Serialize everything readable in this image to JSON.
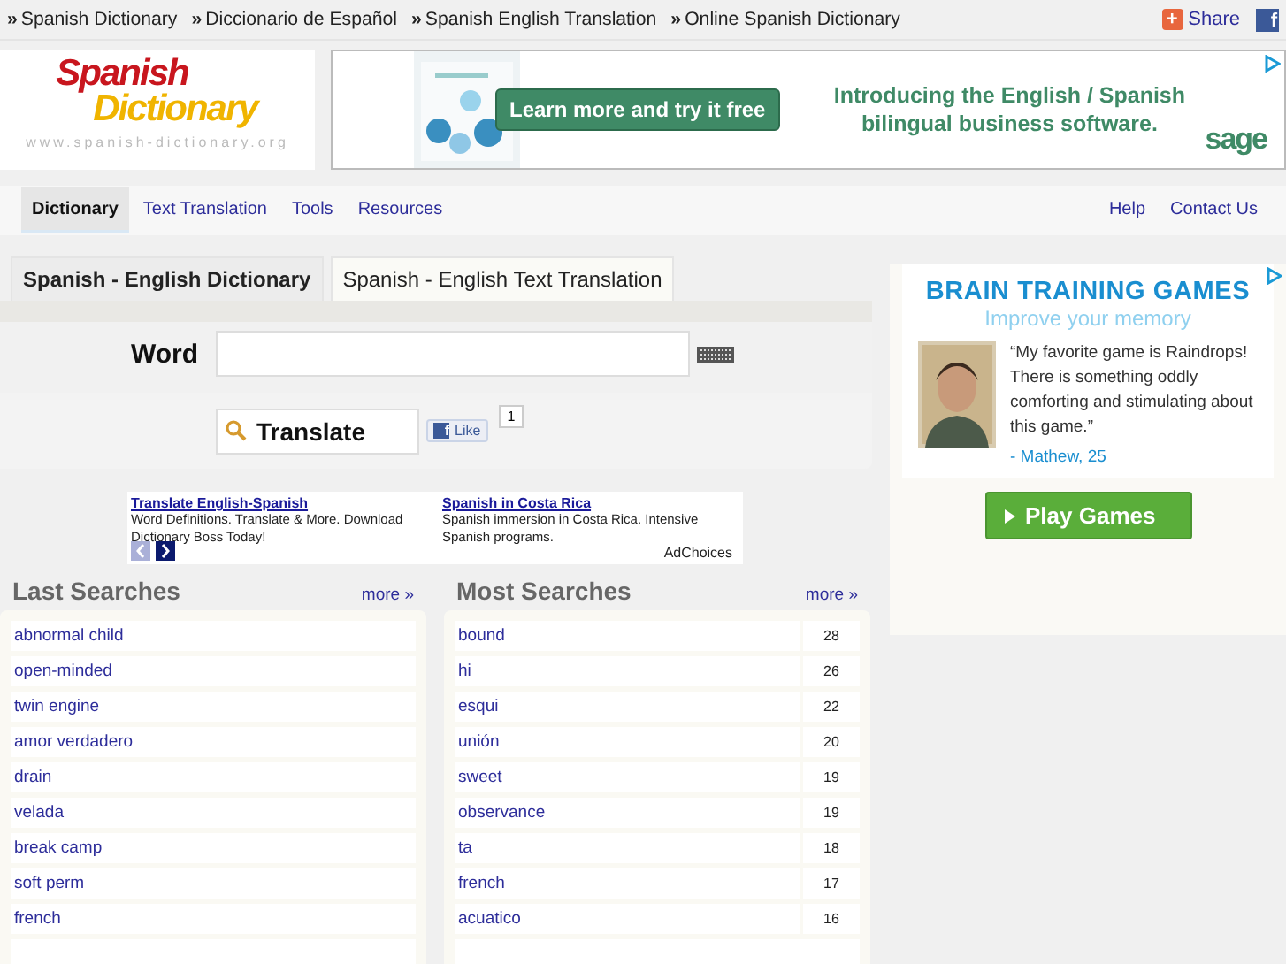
{
  "top_links": [
    {
      "arrow": "»",
      "label": "Spanish Dictionary"
    },
    {
      "arrow": "»",
      "label": "Diccionario de Español"
    },
    {
      "arrow": "»",
      "label": "Spanish English Translation"
    },
    {
      "arrow": "»",
      "label": "Online Spanish Dictionary"
    }
  ],
  "share": {
    "label": "Share",
    "plus": "+",
    "fb": "f"
  },
  "logo": {
    "line1": "Spanish",
    "line2": "Dictionary",
    "url": "www.spanish-dictionary.org"
  },
  "banner": {
    "button": "Learn more and try it free",
    "headline": "Introducing the English / Spanish bilingual business software.",
    "brand": "sage"
  },
  "nav": {
    "items": [
      {
        "label": "Dictionary",
        "selected": true
      },
      {
        "label": "Text Translation",
        "selected": false
      },
      {
        "label": "Tools",
        "selected": false
      },
      {
        "label": "Resources",
        "selected": false
      }
    ],
    "right": [
      {
        "label": "Help"
      },
      {
        "label": "Contact Us"
      }
    ]
  },
  "tabs": [
    {
      "label": "Spanish - English Dictionary",
      "selected": true
    },
    {
      "label": "Spanish - English Text Translation",
      "selected": false
    }
  ],
  "form": {
    "word_label": "Word",
    "translate": "Translate",
    "like": "Like",
    "fb": "f",
    "like_count": "1"
  },
  "text_ads": [
    {
      "title": "Translate English-Spanish",
      "body": "Word Definitions. Translate & More. Download Dictionary Boss Today!"
    },
    {
      "title": "Spanish in Costa Rica",
      "body": "Spanish immersion in Costa Rica. Intensive Spanish programs."
    }
  ],
  "adchoices": "AdChoices",
  "last_searches": {
    "title": "Last Searches",
    "more": "more »",
    "items": [
      "abnormal child",
      "open-minded",
      "twin engine",
      "amor verdadero",
      "drain",
      "velada",
      "break camp",
      "soft perm",
      "french"
    ]
  },
  "most_searches": {
    "title": "Most Searches",
    "more": "more »",
    "items": [
      {
        "word": "bound",
        "count": "28"
      },
      {
        "word": "hi",
        "count": "26"
      },
      {
        "word": "esqui",
        "count": "22"
      },
      {
        "word": "unión",
        "count": "20"
      },
      {
        "word": "sweet",
        "count": "19"
      },
      {
        "word": "observance",
        "count": "19"
      },
      {
        "word": "ta",
        "count": "18"
      },
      {
        "word": "french",
        "count": "17"
      },
      {
        "word": "acuatico",
        "count": "16"
      }
    ]
  },
  "side_ad": {
    "title": "BRAIN TRAINING GAMES",
    "subtitle": "Improve your memory",
    "quote": "“My favorite game is Raindrops! There is something oddly comforting and stimulating about this game.”",
    "author": "- Mathew, 25",
    "button": "Play Games"
  }
}
